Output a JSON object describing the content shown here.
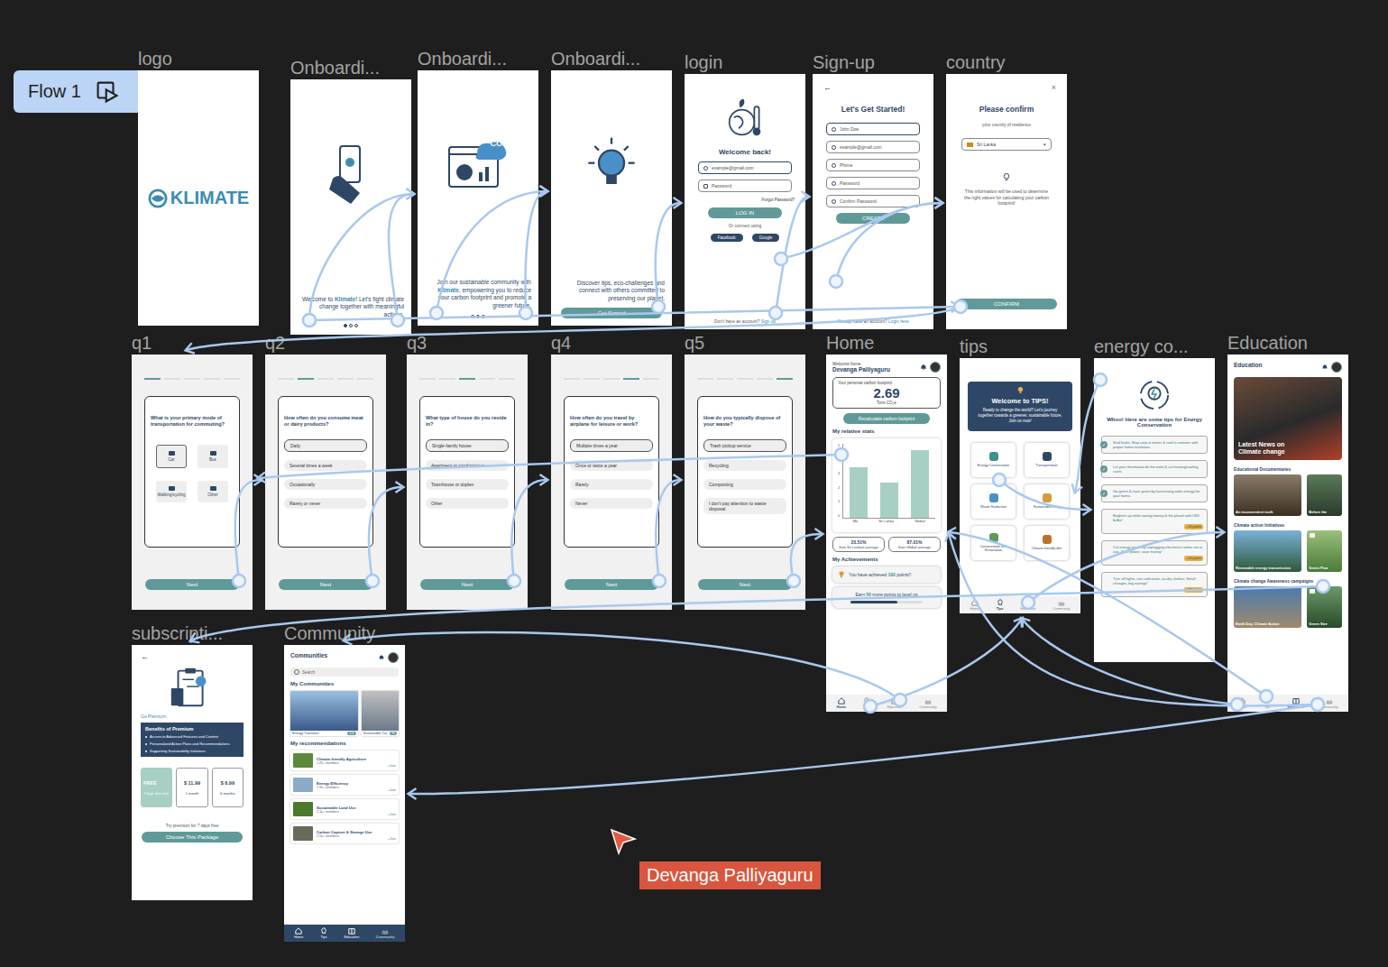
{
  "flow": {
    "label": "Flow 1"
  },
  "collaborator": {
    "name": "Devanga Palliyaguru"
  },
  "logo": {
    "label": "logo",
    "brand": "KLIMATE"
  },
  "onboarding": [
    {
      "label": "Onboardi...",
      "parts": [
        {
          "text": "Welcome to ",
          "highlight": false
        },
        {
          "text": "Klimate",
          "highlight": true
        },
        {
          "text": "! Let's fight climate change together with meaningful actions.",
          "highlight": false
        }
      ],
      "dots": [
        true,
        false,
        false
      ]
    },
    {
      "label": "Onboardi...",
      "badge": "CO₂",
      "parts": [
        {
          "text": "Join our sustainable community with ",
          "highlight": false
        },
        {
          "text": "Klimate",
          "highlight": true
        },
        {
          "text": ", empowering you to reduce your carbon footprint and promote a greener future.",
          "highlight": false
        }
      ],
      "dots": [
        false,
        true,
        false
      ]
    },
    {
      "label": "Onboardi...",
      "parts": [
        {
          "text": "Discover tips, eco-challenges and connect with others committed to preserving our planet.",
          "highlight": false
        }
      ],
      "button": "Get Started"
    }
  ],
  "login": {
    "label": "login",
    "title": "Welcome back!",
    "email": "example@gmail.com",
    "password": "Password",
    "forgot": "Forgot Password?",
    "button": "LOG IN",
    "divider": "Or connect using",
    "socials": [
      "Facebook",
      "Google"
    ],
    "footer": "Don't have an account?",
    "footerLink": "Sign up"
  },
  "signup": {
    "label": "Sign-up",
    "back": "←",
    "title": "Let's Get Started!",
    "fields": [
      {
        "placeholder": "John Doe",
        "focused": true
      },
      {
        "placeholder": "example@gmail.com",
        "focused": false
      },
      {
        "placeholder": "Phone",
        "focused": false
      },
      {
        "placeholder": "Password",
        "focused": false
      },
      {
        "placeholder": "Confirm Password",
        "focused": false
      }
    ],
    "button": "CREATE",
    "footer": "Already have an account?",
    "footerLink": "Login here"
  },
  "country": {
    "label": "country",
    "close": "×",
    "title": "Please confirm",
    "subtitle": "your country of residence",
    "country": "Sri Lanka",
    "caret": "▾",
    "info": "This information will be used to determine the right values for calculating your carbon footprint!",
    "button": "CONFIRM"
  },
  "questions": [
    {
      "label": "q1",
      "kind": "grid",
      "steps": [
        true,
        false,
        false,
        false,
        false
      ],
      "question": "What is your primary mode of transportation for commuting?",
      "options": [
        {
          "label": "Car",
          "selected": true
        },
        {
          "label": "Bus",
          "selected": false
        },
        {
          "label": "Walking/cycling",
          "selected": false
        },
        {
          "label": "Other",
          "selected": false
        }
      ],
      "button": "Next"
    },
    {
      "label": "q2",
      "kind": "list",
      "steps": [
        false,
        true,
        false,
        false,
        false
      ],
      "question": "How often do you consume meat or dairy products?",
      "options": [
        {
          "label": "Daily",
          "selected": true
        },
        {
          "label": "Several times a week",
          "selected": false
        },
        {
          "label": "Occasionally",
          "selected": false
        },
        {
          "label": "Rarely or never",
          "selected": false
        }
      ],
      "button": "Next"
    },
    {
      "label": "q3",
      "kind": "list",
      "steps": [
        false,
        false,
        true,
        false,
        false
      ],
      "question": "What type of house do you reside in?",
      "options": [
        {
          "label": "Single-family house",
          "selected": true
        },
        {
          "label": "Apartment or condominium",
          "selected": false
        },
        {
          "label": "Townhouse or duplex",
          "selected": false
        },
        {
          "label": "Other",
          "selected": false
        }
      ],
      "button": "Next"
    },
    {
      "label": "q4",
      "kind": "list",
      "steps": [
        false,
        false,
        false,
        true,
        false
      ],
      "question": "How often do you travel by airplane for leisure or work?",
      "options": [
        {
          "label": "Multiple times a year",
          "selected": true
        },
        {
          "label": "Once or twice a year",
          "selected": false
        },
        {
          "label": "Rarely",
          "selected": false
        },
        {
          "label": "Never",
          "selected": false
        }
      ],
      "button": "Next"
    },
    {
      "label": "q5",
      "kind": "list",
      "steps": [
        false,
        false,
        false,
        false,
        true
      ],
      "question": "How do you typically dispose of your waste?",
      "options": [
        {
          "label": "Trash pickup service",
          "selected": true
        },
        {
          "label": "Recycling",
          "selected": false
        },
        {
          "label": "Composting",
          "selected": false
        },
        {
          "label": "I don't pay attention to waste disposal",
          "selected": false
        }
      ],
      "button": "Next"
    }
  ],
  "home": {
    "label": "Home",
    "greeting": "Welcome home",
    "user": "Devanga Palliyaguru",
    "footprint": {
      "caption": "Your personal carbon footprint",
      "value": "2.69",
      "unit": "Tons CO₂e"
    },
    "recalc": "Recalculate carbon footprint",
    "statsTitle": "My relative stats",
    "chart": {
      "ticks": [
        "5",
        "4",
        "3",
        "2",
        "1",
        "0"
      ],
      "labels": [
        "Me",
        "Sri Lanka",
        "Global"
      ],
      "values": [
        3.6,
        2.5,
        4.8
      ]
    },
    "comparisons": [
      {
        "value": "23.51%",
        "text": "than Sri Lankan average"
      },
      {
        "value": "87.01%",
        "text": "than Global average"
      }
    ],
    "achievementsTitle": "My Achievements",
    "points": {
      "pre": "You have achieved ",
      "value": "100",
      "post": " points!!"
    },
    "levelUp": {
      "pre": "Earn ",
      "value": "50",
      "post": " more points to level up",
      "level": 0.65
    },
    "nav": [
      {
        "label": "Home",
        "selected": true
      },
      {
        "label": "Tips",
        "selected": false
      },
      {
        "label": "Education",
        "selected": false
      },
      {
        "label": "Community",
        "selected": false
      }
    ]
  },
  "tips": {
    "label": "tips",
    "title": "Welcome to TIPS!",
    "text": "Ready to change the world? Let's journey together towards a greener, sustainable future. Join us now!",
    "categories": [
      {
        "label": "Energy Conservation",
        "color": "#3f8f8c"
      },
      {
        "label": "Transportation",
        "color": "#2f4766"
      },
      {
        "label": "Waste Reduction",
        "color": "#4a90c8"
      },
      {
        "label": "Sustainable living",
        "color": "#d89a3a"
      },
      {
        "label": "Conservation and Restoration",
        "color": "#5f9a5a"
      },
      {
        "label": "Climate-friendly diet",
        "color": "#b8742f"
      }
    ],
    "nav": [
      {
        "label": "Home",
        "selected": false
      },
      {
        "label": "Tips",
        "selected": true
      },
      {
        "label": "Education",
        "selected": false
      },
      {
        "label": "Community",
        "selected": false
      }
    ]
  },
  "energy": {
    "label": "energy co...",
    "title": "Whoo! Here are some tips for Energy Conservation",
    "tips": [
      {
        "text": "Seal leaks: Stay cozy in winter & cool in summer with proper home insulation.",
        "done": true
      },
      {
        "text": "Let your thermostat do the work & cut heating/cooling costs.",
        "done": true
      },
      {
        "text": "Go green & save green by harnessing solar energy for your home.",
        "done": true
      },
      {
        "text": "Brighten up while saving money & the planet with LED bulbs!",
        "done": false,
        "points": "+10 points"
      },
      {
        "text": "Cut energy waste by unplugging electronics when not in use. Save power, save money!",
        "done": false,
        "points": "+10 points"
      },
      {
        "text": "Turn off lights, use cold water, air-dry clothes. Small changes, big savings!",
        "done": false,
        "points": "+10 points"
      }
    ]
  },
  "education": {
    "label": "Education",
    "title": "Education",
    "hero": "Latest News on Climate change",
    "sections": [
      {
        "title": "Educational Documentaries",
        "cards": [
          {
            "caption": "An inconvenient truth",
            "locked": false
          },
          {
            "caption": "Before the",
            "locked": false
          }
        ]
      },
      {
        "title": "Climate action Initiatives",
        "cards": [
          {
            "caption": "Renewable energy transmission",
            "locked": false
          },
          {
            "caption": "Green Fina",
            "locked": true
          }
        ]
      },
      {
        "title": "Climate change Awareness campaigns",
        "cards": [
          {
            "caption": "Earth Day, Climate Action",
            "locked": false
          },
          {
            "caption": "Green Stre",
            "locked": true
          }
        ]
      }
    ],
    "nav": [
      {
        "label": "Home",
        "selected": false
      },
      {
        "label": "Tips",
        "selected": false
      },
      {
        "label": "Education",
        "selected": true
      },
      {
        "label": "Community",
        "selected": false
      }
    ]
  },
  "subscription": {
    "label": "subscripti...",
    "back": "←",
    "heading": "Go Premium",
    "benefitsTitle": "Benefits of Premium",
    "benefits": [
      "Access to Advanced Features and Content",
      "Personalized Action Plans and Recommendations",
      "Supporting Sustainability Initiatives"
    ],
    "plans": [
      {
        "price": "FREE",
        "period": "7 days free trial",
        "selected": true
      },
      {
        "price": "$ 11.99",
        "period": "1 month",
        "selected": false
      },
      {
        "price": "$ 6.99",
        "period": "6 months",
        "selected": false
      }
    ],
    "note": "Try premium for 7 days free",
    "button": "Choose This Package"
  },
  "community": {
    "label": "Community",
    "title": "Communities",
    "search": "Search",
    "mineTitle": "My Communities",
    "mine": [
      {
        "name": "Energy Transition",
        "count": "12k"
      },
      {
        "name": "Sustainable Tra",
        "count": "8k"
      }
    ],
    "recsTitle": "My recommendations",
    "recs": [
      {
        "name": "Climate-friendly Agriculture",
        "members": "1.2k+ members",
        "action": "+Join"
      },
      {
        "name": "Energy Efficiency",
        "members": "1.9k+ members",
        "action": "+Join"
      },
      {
        "name": "Sustainable Land Use",
        "members": "2.1k+ members",
        "action": "+Join"
      },
      {
        "name": "Carbon Capture & Storage Use",
        "members": "2.5k+ members",
        "action": "+Join"
      }
    ],
    "nav": [
      {
        "label": "Home",
        "selected": false
      },
      {
        "label": "Tips",
        "selected": false
      },
      {
        "label": "Education",
        "selected": false
      },
      {
        "label": "Community",
        "selected": true
      }
    ]
  }
}
